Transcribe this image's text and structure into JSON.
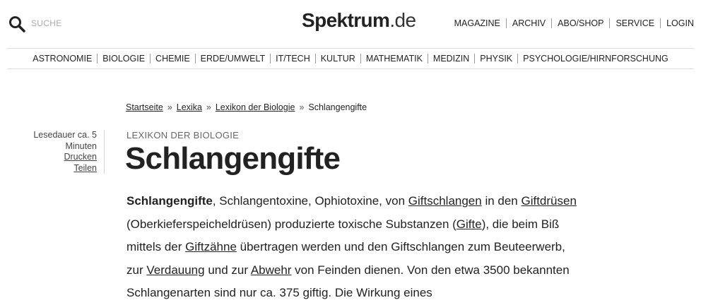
{
  "header": {
    "search_icon": "search-icon",
    "search_label": "SUCHE",
    "logo_brand": "Spektrum",
    "logo_tld": ".de",
    "nav": [
      "MAGAZINE",
      "ARCHIV",
      "ABO/SHOP",
      "SERVICE",
      "LOGIN"
    ]
  },
  "categories": [
    "ASTRONOMIE",
    "BIOLOGIE",
    "CHEMIE",
    "ERDE/UMWELT",
    "IT/TECH",
    "KULTUR",
    "MATHEMATIK",
    "MEDIZIN",
    "PHYSIK",
    "PSYCHOLOGIE/HIRNFORSCHUNG"
  ],
  "breadcrumb": {
    "items": [
      "Startseite",
      "Lexika",
      "Lexikon der Biologie"
    ],
    "current": "Schlangengifte",
    "separator": "»"
  },
  "meta": {
    "reading_time": "Lesedauer ca. 5 Minuten",
    "print": "Drucken",
    "share": "Teilen"
  },
  "article": {
    "kicker": "LEXIKON DER BIOLOGIE",
    "title": "Schlangengifte",
    "body": [
      {
        "text": "Schlangengifte",
        "style": "bold"
      },
      {
        "text": ", Schlangentoxine, Ophiotoxine, von "
      },
      {
        "text": "Giftschlangen",
        "style": "link"
      },
      {
        "text": " in den "
      },
      {
        "text": "Giftdrüsen",
        "style": "link"
      },
      {
        "text": " (Oberkieferspeicheldrüsen) produzierte toxische Substanzen ("
      },
      {
        "text": "Gifte",
        "style": "link"
      },
      {
        "text": "), die beim Biß mittels der "
      },
      {
        "text": "Giftzähne",
        "style": "link"
      },
      {
        "text": " übertragen werden und den Giftschlangen zum Beuteerwerb, zur "
      },
      {
        "text": "Verdauung",
        "style": "link"
      },
      {
        "text": " und zur "
      },
      {
        "text": "Abwehr",
        "style": "link"
      },
      {
        "text": " von Feinden dienen. Von den etwa 3500 bekannten Schlangenarten sind nur ca. 375 giftig. Die Wirkung eines"
      }
    ]
  }
}
